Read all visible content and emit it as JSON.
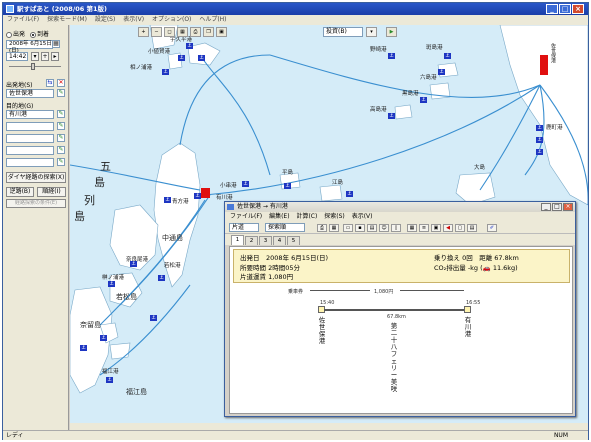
{
  "app": {
    "title": "駅すぱあと (2008/06 第1版)",
    "menu": [
      "ファイル(F)",
      "探索モード(M)",
      "設定(S)",
      "表示(V)",
      "オプション(O)",
      "ヘルプ(H)"
    ]
  },
  "toolbar": {
    "dest_combo": "投資(B)"
  },
  "left_panel": {
    "mode_depart": "出発",
    "mode_arrive": "到着",
    "date": "2008年 6月15日(日)",
    "time": "14:42",
    "from_label": "出発地(S)",
    "from_value": "佐世保港",
    "to_label": "目的地(G)",
    "to_value": "有川港",
    "timetable_button": "ダイヤ経路の探索(X)",
    "reverse_button": "逆路(B)",
    "swap_button": "順経(I)",
    "extra_button": "経路探索の条件(E)"
  },
  "map": {
    "labels": [
      {
        "t": "相ノ浦港",
        "k": "p"
      },
      {
        "t": "大島港",
        "k": "p"
      },
      {
        "t": "小値賀港",
        "k": "p"
      },
      {
        "t": "宇久平港",
        "k": "p"
      },
      {
        "t": "野崎港",
        "k": "p"
      },
      {
        "t": "斑島港",
        "k": "p"
      },
      {
        "t": "六島港",
        "k": "p"
      },
      {
        "t": "前島港",
        "k": "p"
      },
      {
        "t": "黒島港",
        "k": "p"
      },
      {
        "t": "高島港",
        "k": "p"
      },
      {
        "t": "鹿町港",
        "k": "p"
      },
      {
        "t": "佐世保港",
        "k": "p"
      },
      {
        "t": "青方港",
        "k": "p"
      },
      {
        "t": "有川港",
        "k": "p"
      },
      {
        "t": "小串港",
        "k": "p"
      },
      {
        "t": "平島",
        "k": "p"
      },
      {
        "t": "江島",
        "k": "p"
      },
      {
        "t": "大島",
        "k": "p"
      },
      {
        "t": "奈良尾港",
        "k": "p"
      },
      {
        "t": "若松港",
        "k": "p"
      },
      {
        "t": "榊ノ浦港",
        "k": "p"
      },
      {
        "t": "中通島",
        "k": "p"
      },
      {
        "t": "若松島",
        "k": "p"
      },
      {
        "t": "奈留島",
        "k": "p"
      },
      {
        "t": "福江港",
        "k": "p"
      },
      {
        "t": "福江島",
        "k": "p"
      },
      {
        "t": "五",
        "k": "b"
      },
      {
        "t": "島",
        "k": "b"
      },
      {
        "t": "列",
        "k": "b"
      },
      {
        "t": "島",
        "k": "b"
      }
    ]
  },
  "status": {
    "left": "レディ",
    "right": "NUM"
  },
  "route_dialog": {
    "title": "佐世保港 → 有川港",
    "menu": [
      "ファイル(F)",
      "編集(E)",
      "計算(C)",
      "探索(S)",
      "表示(V)"
    ],
    "sel1": "片道",
    "sel2": "探索順",
    "tabs": [
      "1",
      "2",
      "3",
      "4",
      "5"
    ],
    "summary": {
      "date": "出発日　2008年 6月15日(日)",
      "duration": "所要時間 2時間05分",
      "fare": "片道運賃 1,080円",
      "transfers": "乗り換え 0回　距離 67.8km",
      "co2": "CO₂排出量 -kg (🚗 11.6kg)"
    },
    "fare_label": "乗車券",
    "fare_amount": "1,080円",
    "dep_time": "15:40",
    "arr_time": "16:55",
    "distance": "67.8km",
    "origin": "佐世保港",
    "line": "第二十八フェリー美咲",
    "destination": "有川港"
  },
  "colors": {
    "sea": "#d5ecf8",
    "route": "#3a8fd0",
    "land": "#ffffff",
    "port": "#1d35c2",
    "origin_marker": "#e01010"
  }
}
